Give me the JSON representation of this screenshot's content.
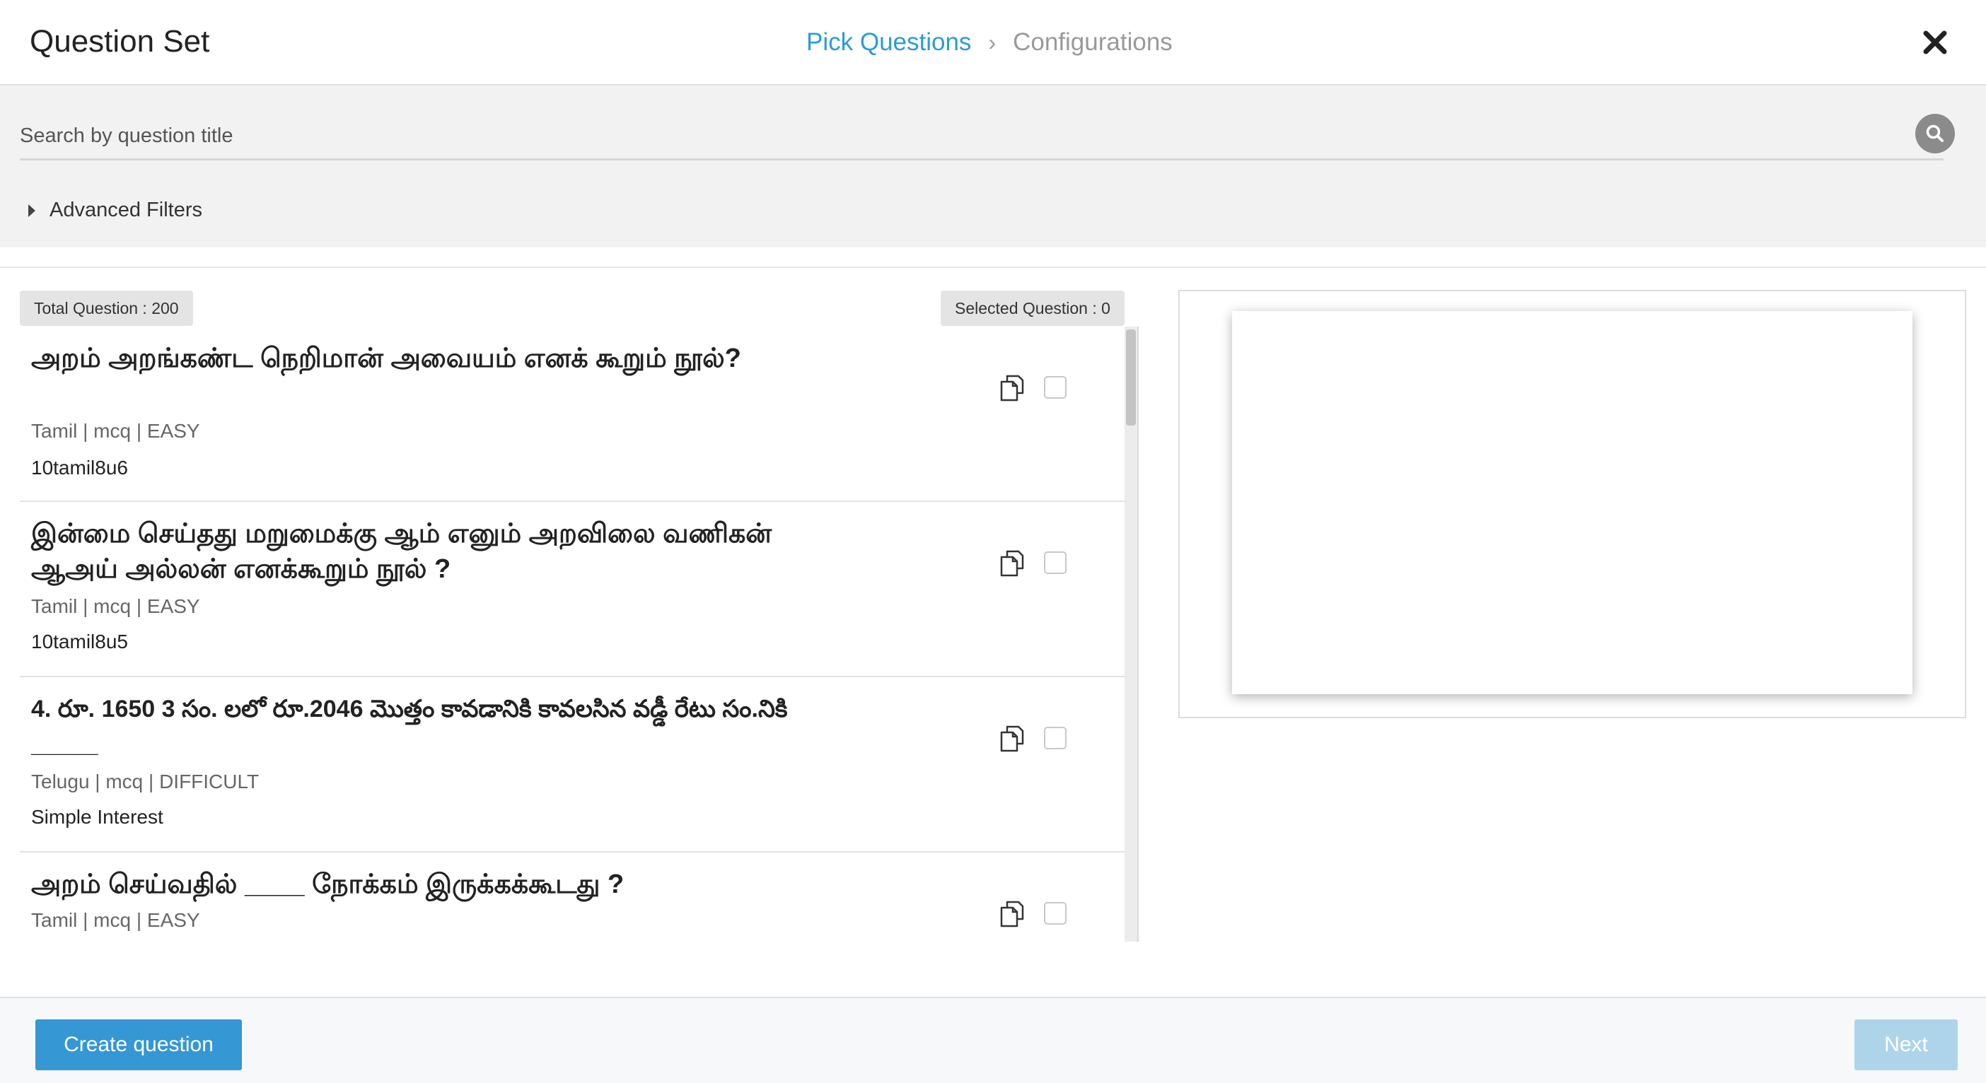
{
  "header": {
    "title": "Question Set",
    "steps": [
      {
        "label": "Pick Questions",
        "active": true
      },
      {
        "label": "Configurations",
        "active": false
      }
    ],
    "step_separator": "›",
    "close_icon": "close-x-icon"
  },
  "search": {
    "placeholder": "Search by question title",
    "value": "",
    "icon": "search-icon"
  },
  "filters": {
    "label": "Advanced Filters",
    "expanded": false
  },
  "counts": {
    "total_label": "Total Question : 200",
    "selected_label": "Selected Question : 0"
  },
  "questions": [
    {
      "title": " அறம் அறங்கண்ட நெறிமான் அவையம் எனக் கூறும் நூல்?",
      "meta": "Tamil | mcq | EASY",
      "topic": "10tamil8u6",
      "selected": false
    },
    {
      "title": "இன்மை செய்தது மறுமைக்கு ஆம் எனும் அறவிலை வணிகன் ஆஅய் அல்லன் எனக்கூறும் நூல் ?",
      "meta": "Tamil | mcq | EASY",
      "topic": "10tamil8u5",
      "selected": false
    },
    {
      "title": "4. రూ. 1650  3 సం. లలో రూ.2046 మొత్తం కావడానికి కావలసిన వడ్డీ రేటు సం.నికి _____",
      "meta": "Telugu | mcq | DIFFICULT",
      "topic": "Simple Interest",
      "selected": false
    },
    {
      "title": "அறம் செய்வதில் ____ நோக்கம் இருக்கக்கூடது ?",
      "meta": "Tamil | mcq | EASY",
      "topic": "",
      "selected": false
    }
  ],
  "footer": {
    "create_label": "Create question",
    "next_label": "Next"
  },
  "colors": {
    "accent": "#2c9bd7",
    "primary_button": "#3597d3",
    "disabled_button": "#aed4ea",
    "band_background": "#f2f2f2"
  }
}
